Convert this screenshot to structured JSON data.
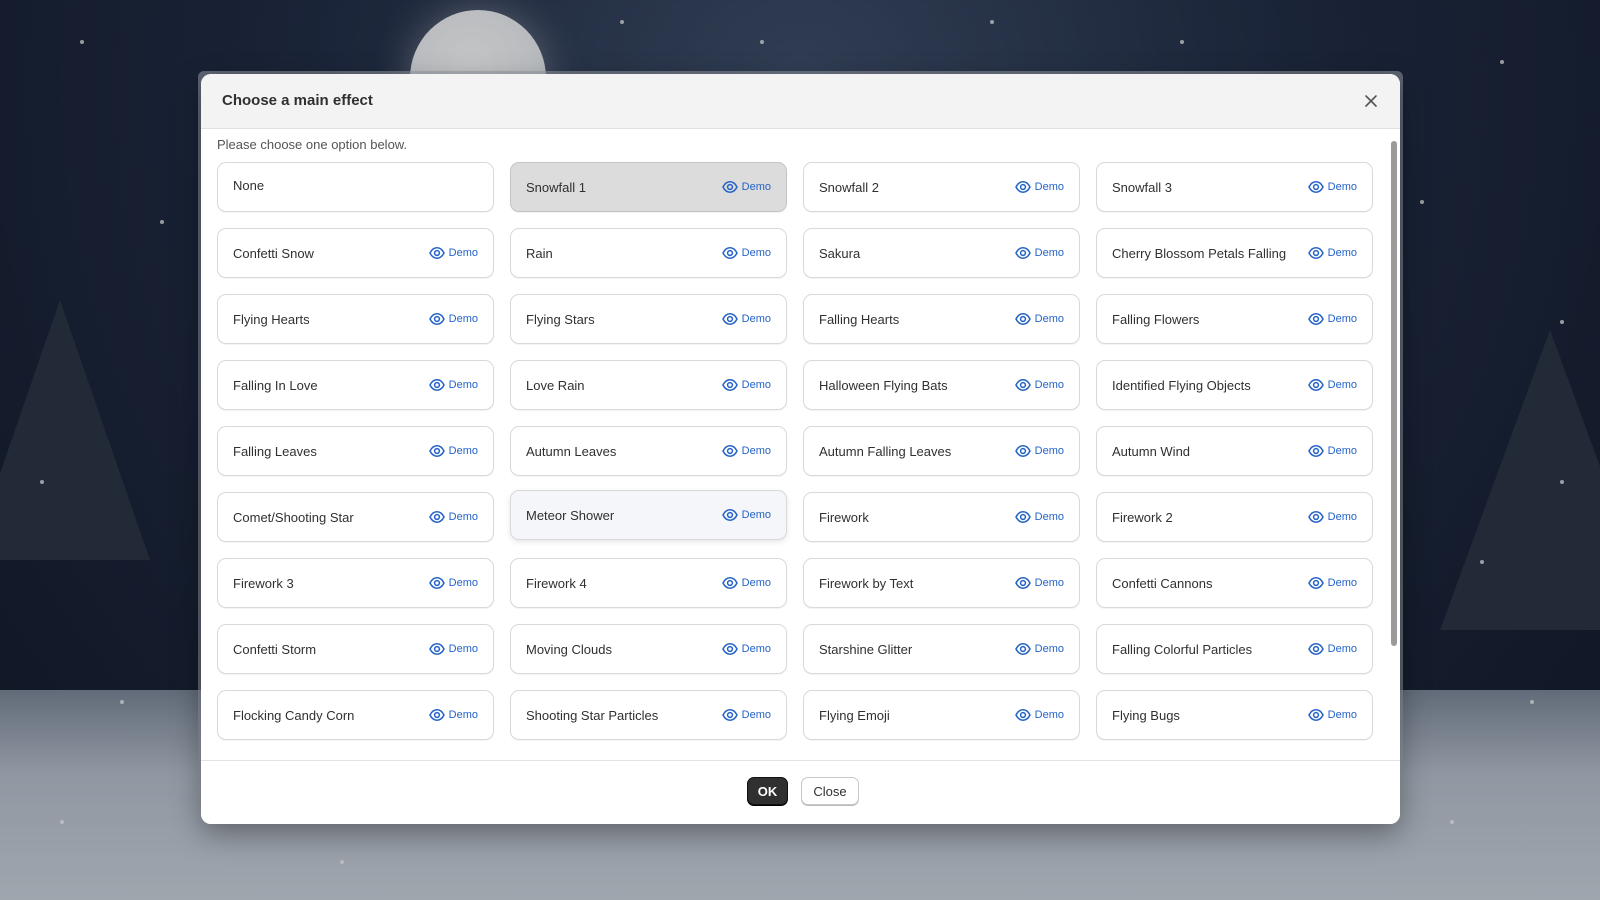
{
  "dialog": {
    "title": "Choose a main effect",
    "instruction": "Please choose one option below.",
    "demo_label": "Demo",
    "options": [
      {
        "label": "None",
        "has_demo": false,
        "state": "default"
      },
      {
        "label": "Snowfall 1",
        "has_demo": true,
        "state": "selected"
      },
      {
        "label": "Snowfall 2",
        "has_demo": true,
        "state": "default"
      },
      {
        "label": "Snowfall 3",
        "has_demo": true,
        "state": "default"
      },
      {
        "label": "Confetti Snow",
        "has_demo": true,
        "state": "default"
      },
      {
        "label": "Rain",
        "has_demo": true,
        "state": "default"
      },
      {
        "label": "Sakura",
        "has_demo": true,
        "state": "default"
      },
      {
        "label": "Cherry Blossom Petals Falling",
        "has_demo": true,
        "state": "default"
      },
      {
        "label": "Flying Hearts",
        "has_demo": true,
        "state": "default"
      },
      {
        "label": "Flying Stars",
        "has_demo": true,
        "state": "default"
      },
      {
        "label": "Falling Hearts",
        "has_demo": true,
        "state": "default"
      },
      {
        "label": "Falling Flowers",
        "has_demo": true,
        "state": "default"
      },
      {
        "label": "Falling In Love",
        "has_demo": true,
        "state": "default"
      },
      {
        "label": "Love Rain",
        "has_demo": true,
        "state": "default"
      },
      {
        "label": "Halloween Flying Bats",
        "has_demo": true,
        "state": "default"
      },
      {
        "label": "Identified Flying Objects",
        "has_demo": true,
        "state": "default"
      },
      {
        "label": "Falling Leaves",
        "has_demo": true,
        "state": "default"
      },
      {
        "label": "Autumn Leaves",
        "has_demo": true,
        "state": "default"
      },
      {
        "label": "Autumn Falling Leaves",
        "has_demo": true,
        "state": "default"
      },
      {
        "label": "Autumn Wind",
        "has_demo": true,
        "state": "default"
      },
      {
        "label": "Comet/Shooting Star",
        "has_demo": true,
        "state": "default"
      },
      {
        "label": "Meteor Shower",
        "has_demo": true,
        "state": "hover"
      },
      {
        "label": "Firework",
        "has_demo": true,
        "state": "default"
      },
      {
        "label": "Firework 2",
        "has_demo": true,
        "state": "default"
      },
      {
        "label": "Firework 3",
        "has_demo": true,
        "state": "default"
      },
      {
        "label": "Firework 4",
        "has_demo": true,
        "state": "default"
      },
      {
        "label": "Firework by Text",
        "has_demo": true,
        "state": "default"
      },
      {
        "label": "Confetti Cannons",
        "has_demo": true,
        "state": "default"
      },
      {
        "label": "Confetti Storm",
        "has_demo": true,
        "state": "default"
      },
      {
        "label": "Moving Clouds",
        "has_demo": true,
        "state": "default"
      },
      {
        "label": "Starshine Glitter",
        "has_demo": true,
        "state": "default"
      },
      {
        "label": "Falling Colorful Particles",
        "has_demo": true,
        "state": "default"
      },
      {
        "label": "Flocking Candy Corn",
        "has_demo": true,
        "state": "default"
      },
      {
        "label": "Shooting Star Particles",
        "has_demo": true,
        "state": "default"
      },
      {
        "label": "Flying Emoji",
        "has_demo": true,
        "state": "default"
      },
      {
        "label": "Flying Bugs",
        "has_demo": true,
        "state": "default"
      }
    ],
    "buttons": {
      "ok": "OK",
      "close": "Close"
    },
    "icons": {
      "close": "close-icon",
      "demo": "eye-icon"
    },
    "colors": {
      "accent": "#2563c7",
      "primary_button": "#303030",
      "selected_option": "#dcdcdc"
    }
  }
}
